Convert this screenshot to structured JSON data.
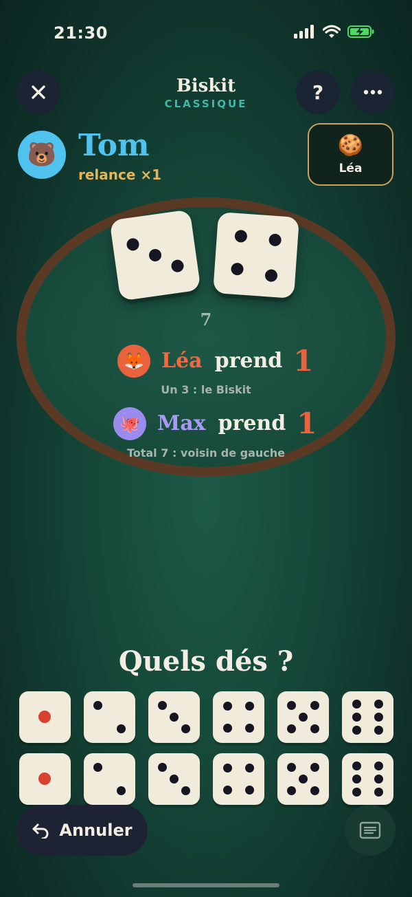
{
  "status": {
    "time": "21:30"
  },
  "header": {
    "title": "Biskit",
    "subtitle": "CLASSIQUE",
    "close_icon": "close-icon",
    "help_label": "?",
    "more_icon": "more-icon"
  },
  "current_player": {
    "avatar_emoji": "🐻",
    "avatar_color": "#4fc2ee",
    "name": "Tom",
    "name_color": "#4fc2ee",
    "status": "relance ×1"
  },
  "biskit_holder": {
    "icon": "cookie-icon",
    "emoji": "🍪",
    "name": "Léa"
  },
  "roll": {
    "dice": [
      3,
      4
    ],
    "total": "7"
  },
  "takes": [
    {
      "emoji": "🦊",
      "avatar_color": "#e8623d",
      "name": "Léa",
      "name_color": "#ef6a44",
      "verb": "prend",
      "amount": "1",
      "reason": "Un 3 : le Biskit"
    },
    {
      "emoji": "🐙",
      "avatar_color": "#9a8cef",
      "name": "Max",
      "name_color": "#a79af5",
      "verb": "prend",
      "amount": "1",
      "reason": "Total 7 : voisin de gauche"
    }
  ],
  "picker": {
    "question": "Quels dés ?",
    "rows": [
      [
        1,
        2,
        3,
        4,
        5,
        6
      ],
      [
        1,
        2,
        3,
        4,
        5,
        6
      ]
    ]
  },
  "footer": {
    "undo_label": "Annuler",
    "undo_icon": "undo-icon",
    "log_icon": "log-icon"
  }
}
